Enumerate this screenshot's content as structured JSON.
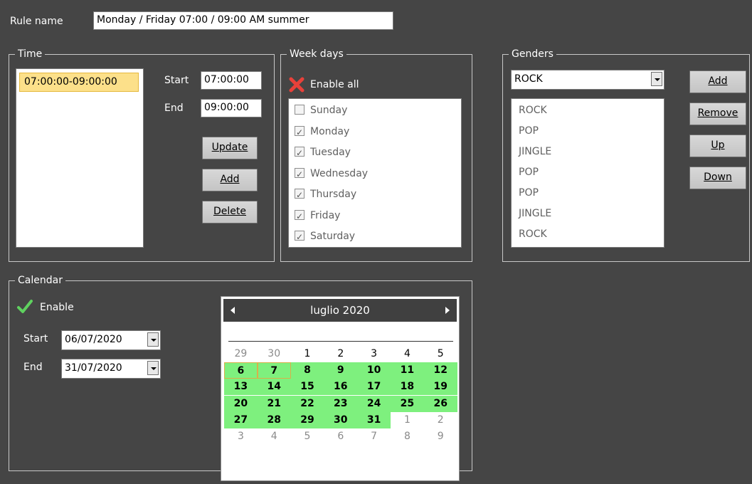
{
  "rule_name": {
    "label": "Rule name",
    "value": "Monday / Friday 07:00 / 09:00 AM summer"
  },
  "time": {
    "title": "Time",
    "items": [
      "07:00:00-09:00:00"
    ],
    "start_label": "Start",
    "start_value": "07:00:00",
    "end_label": "End",
    "end_value": "09:00:00",
    "buttons": {
      "update": "Update",
      "add": "Add",
      "delete": "Delete"
    }
  },
  "weekdays": {
    "title": "Week days",
    "enable_all_label": "Enable all",
    "days": [
      {
        "label": "Sunday",
        "checked": false
      },
      {
        "label": "Monday",
        "checked": true
      },
      {
        "label": "Tuesday",
        "checked": true
      },
      {
        "label": "Wednesday",
        "checked": true
      },
      {
        "label": "Thursday",
        "checked": true
      },
      {
        "label": "Friday",
        "checked": true
      },
      {
        "label": "Saturday",
        "checked": true
      }
    ]
  },
  "genders": {
    "title": "Genders",
    "selected": "ROCK",
    "items": [
      "ROCK",
      "POP",
      "JINGLE",
      "POP",
      "POP",
      "JINGLE",
      "ROCK"
    ],
    "buttons": {
      "add": "Add",
      "remove": "Remove",
      "up": "Up",
      "down": "Down"
    }
  },
  "calendar": {
    "title": "Calendar",
    "enable_label": "Enable",
    "start_label": "Start",
    "start_value": "06/07/2020",
    "end_label": "End",
    "end_value": "31/07/2020",
    "month_label": "luglio 2020",
    "weeks": [
      [
        "29",
        "30",
        "1",
        "2",
        "3",
        "4",
        "5"
      ],
      [
        "6",
        "7",
        "8",
        "9",
        "10",
        "11",
        "12"
      ],
      [
        "13",
        "14",
        "15",
        "16",
        "17",
        "18",
        "19"
      ],
      [
        "20",
        "21",
        "22",
        "23",
        "24",
        "25",
        "26"
      ],
      [
        "27",
        "28",
        "29",
        "30",
        "31",
        "1",
        "2"
      ],
      [
        "3",
        "4",
        "5",
        "6",
        "7",
        "8",
        "9"
      ]
    ],
    "colors": {
      "range": "#7ef07e",
      "selected_border": "#d9b04a"
    }
  }
}
